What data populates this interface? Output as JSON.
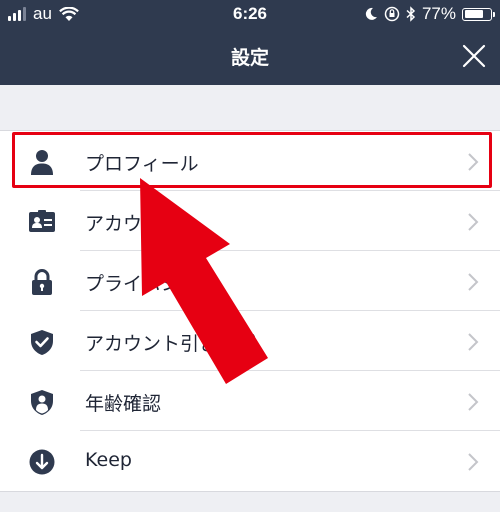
{
  "status_bar": {
    "carrier": "au",
    "time": "6:26",
    "battery_percent": "77%",
    "battery_level": 0.77
  },
  "header": {
    "title": "設定",
    "close_icon": "close-icon"
  },
  "settings_items": [
    {
      "label": "プロフィール",
      "icon": "person-icon"
    },
    {
      "label": "アカウ",
      "icon": "id-card-icon"
    },
    {
      "label": "プライバシ…理",
      "icon": "lock-icon"
    },
    {
      "label": "アカウント引き継ぎ",
      "icon": "shield-check-icon"
    },
    {
      "label": "年齢確認",
      "icon": "shield-person-icon"
    },
    {
      "label": "Keep",
      "icon": "keep-download-icon"
    }
  ],
  "colors": {
    "navbar": "#2f3a4f",
    "highlight": "#e60012",
    "icon": "#2f3a4f",
    "background": "#eeeff3"
  }
}
